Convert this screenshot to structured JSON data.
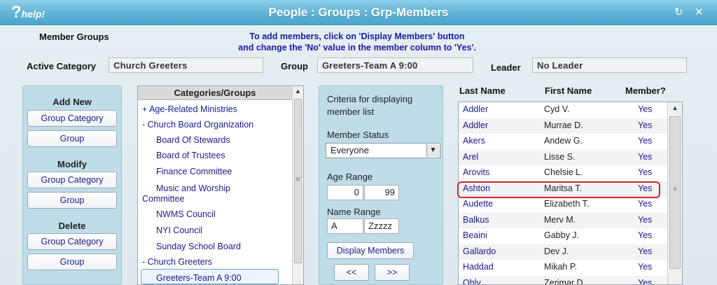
{
  "window": {
    "help_label": "help!",
    "title": "People : Groups : Grp-Members",
    "refresh_icon": "refresh-icon",
    "close_icon": "close-icon"
  },
  "header": {
    "member_groups_label": "Member Groups",
    "instruction_line1": "To add members, click on 'Display Members' button",
    "instruction_line2": "and change the 'No' value in the member column to 'Yes'.",
    "active_category_label": "Active Category",
    "active_category_value": "Church Greeters",
    "group_label": "Group",
    "group_value": "Greeters-Team A  9:00",
    "leader_label": "Leader",
    "leader_value": "No Leader"
  },
  "left_panel": {
    "add_new_label": "Add New",
    "add_group_category": "Group Category",
    "add_group": "Group",
    "modify_label": "Modify",
    "modify_group_category": "Group Category",
    "modify_group": "Group",
    "delete_label": "Delete",
    "delete_group_category": "Group Category",
    "delete_group": "Group"
  },
  "categories": {
    "header": "Categories/Groups",
    "items": [
      "+ Age-Related Ministries",
      "- Church Board Organization",
      "Board Of Stewards",
      "Board of Trustees",
      "Finance Committee",
      "Music and Worship",
      "Committee",
      "NWMS Council",
      "NYI Council",
      "Sunday School Board",
      "- Church Greeters",
      "Greeters-Team A 9:00"
    ]
  },
  "criteria": {
    "intro_line1": "Criteria for displaying",
    "intro_line2": "member list",
    "member_status_label": "Member Status",
    "member_status_value": "Everyone",
    "age_range_label": "Age Range",
    "age_from": "0",
    "age_to": "99",
    "name_range_label": "Name Range",
    "name_from": "A",
    "name_to": "Zzzzz",
    "display_button": "Display Members",
    "prev_button": "<<",
    "next_button": ">>"
  },
  "members": {
    "columns": [
      "Last Name",
      "First Name",
      "Member?"
    ],
    "rows": [
      [
        "Addler",
        "Cyd V.",
        "Yes"
      ],
      [
        "Addler",
        "Murrae D.",
        "Yes"
      ],
      [
        "Akers",
        "Andew G.",
        "Yes"
      ],
      [
        "Arel",
        "Lisse S.",
        "Yes"
      ],
      [
        "Arovits",
        "Chelsie L.",
        "Yes"
      ],
      [
        "Ashton",
        "Maritsa T.",
        "Yes"
      ],
      [
        "Audette",
        "Elizabeth T.",
        "Yes"
      ],
      [
        "Balkus",
        "Merv M.",
        "Yes"
      ],
      [
        "Beaini",
        "Gabby J.",
        "Yes"
      ],
      [
        "Gallardo",
        "Dev J.",
        "Yes"
      ],
      [
        "Haddad",
        "Mikah P.",
        "Yes"
      ],
      [
        "Ohly",
        "Zerimar D.",
        "Yes"
      ]
    ],
    "highlighted_row": 5
  },
  "colors": {
    "accent_blue": "#1a1a8c",
    "highlight_red": "#d0262b",
    "panel_blue": "#bfdce9"
  }
}
